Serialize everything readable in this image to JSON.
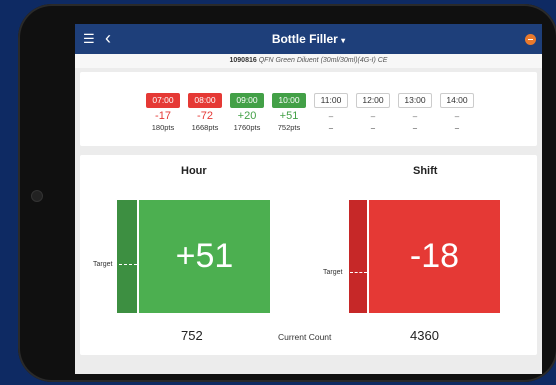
{
  "header": {
    "title": "Bottle Filler",
    "menu_icon": "hamburger-menu-icon",
    "back_icon": "chevron-left-icon",
    "status_icon": "minus-circle-icon",
    "status_color": "#e9792c"
  },
  "product": {
    "code": "1090816",
    "name": "QFN Green Diluent (30ml/30ml)(4G-I) CE"
  },
  "hours": [
    {
      "time": "07:00",
      "delta": "-17",
      "pts": "180pts",
      "status": "red"
    },
    {
      "time": "08:00",
      "delta": "-72",
      "pts": "1668pts",
      "status": "red"
    },
    {
      "time": "09:00",
      "delta": "+20",
      "pts": "1760pts",
      "status": "green"
    },
    {
      "time": "10:00",
      "delta": "+51",
      "pts": "752pts",
      "status": "green"
    },
    {
      "time": "11:00",
      "delta": "–",
      "pts": "–",
      "status": "none"
    },
    {
      "time": "12:00",
      "delta": "–",
      "pts": "–",
      "status": "none"
    },
    {
      "time": "13:00",
      "delta": "–",
      "pts": "–",
      "status": "none"
    },
    {
      "time": "14:00",
      "delta": "–",
      "pts": "–",
      "status": "none"
    }
  ],
  "hour_panel": {
    "title": "Hour",
    "value": "+51",
    "target_label": "Target",
    "count": "752",
    "color": "#4caf50",
    "bar_color": "#3d8f41"
  },
  "shift_panel": {
    "title": "Shift",
    "value": "-18",
    "target_label": "Target",
    "count": "4360",
    "color": "#e53935",
    "bar_color": "#c62828"
  },
  "current_count_label": "Current Count",
  "colors": {
    "topbar": "#1e3f7a",
    "red": "#e53935",
    "green": "#43a047"
  }
}
